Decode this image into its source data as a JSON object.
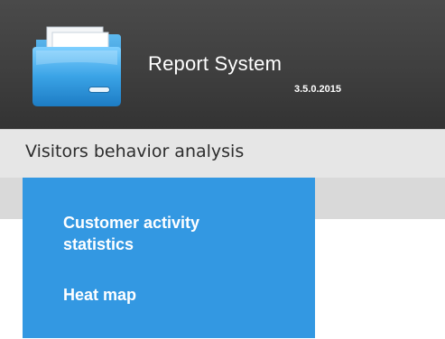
{
  "app": {
    "title": "Report System",
    "version": "3.5.0.2015",
    "logo_icon": "folder-icon"
  },
  "menu": {
    "active_section": "Visitors behavior analysis",
    "items": [
      {
        "label_line1": "Customer activity",
        "label_line2": "statistics"
      },
      {
        "label_line1": "Heat map"
      }
    ]
  },
  "colors": {
    "header_bg": "#3f3f3f",
    "menu_bg": "#e6e6e6",
    "dropdown_bg": "#3398e2",
    "dropdown_text": "#ffffff",
    "logo_blue": "#4db1ec"
  }
}
